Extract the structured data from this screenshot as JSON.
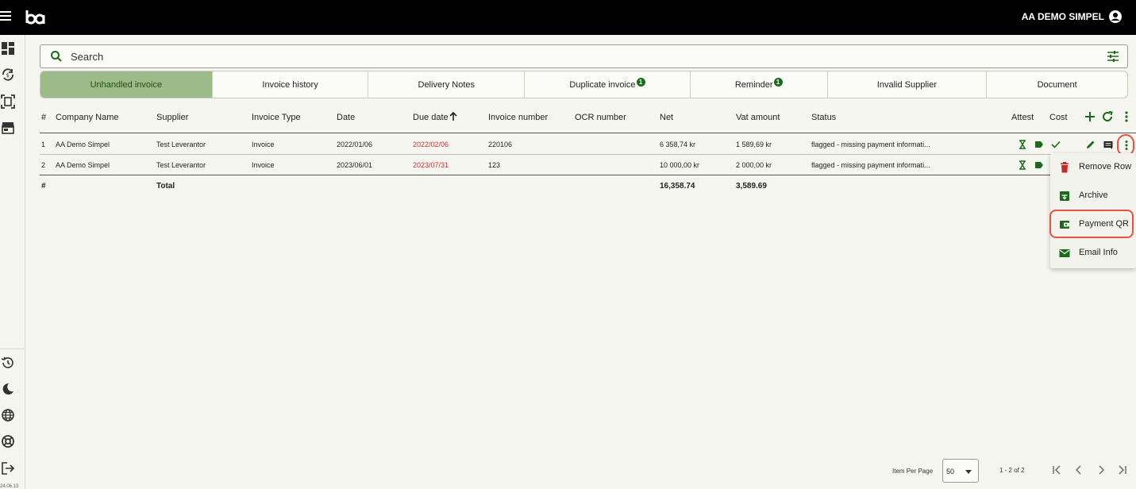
{
  "header": {
    "user_name": "AA DEMO SIMPEL"
  },
  "sidebar": {
    "version": "24.06.13"
  },
  "search": {
    "placeholder": "Search"
  },
  "tabs": [
    {
      "label": "Unhandled invoice",
      "badge": ""
    },
    {
      "label": "Invoice history",
      "badge": ""
    },
    {
      "label": "Delivery Notes",
      "badge": ""
    },
    {
      "label": "Duplicate invoice",
      "badge": "1"
    },
    {
      "label": "Reminder",
      "badge": "1"
    },
    {
      "label": "Invalid Supplier",
      "badge": ""
    },
    {
      "label": "Document",
      "badge": ""
    }
  ],
  "table": {
    "columns": {
      "index": "#",
      "company": "Company Name",
      "supplier": "Supplier",
      "type": "Invoice Type",
      "date": "Date",
      "due": "Due date",
      "number": "Invoice number",
      "ocr": "OCR number",
      "net": "Net",
      "vat": "Vat amount",
      "status": "Status",
      "attest": "Attest",
      "cost": "Cost"
    },
    "rows": [
      {
        "index": "1",
        "company": "AA Demo Simpel",
        "supplier": "Test Leverantor",
        "type": "Invoice",
        "date": "2022/01/06",
        "due": "2022/02/06",
        "number": "220106",
        "ocr": "",
        "net": "6 358,74 kr",
        "vat": "1 589,69 kr",
        "status": "flagged - missing payment informati..."
      },
      {
        "index": "2",
        "company": "AA Demo Simpel",
        "supplier": "Test Leverantor",
        "type": "Invoice",
        "date": "2023/06/01",
        "due": "2023/07/31",
        "number": "123",
        "ocr": "",
        "net": "10 000,00 kr",
        "vat": "2 000,00 kr",
        "status": "flagged - missing payment informati..."
      }
    ],
    "total": {
      "index": "#",
      "label": "Total",
      "net": "16,358.74",
      "vat": "3,589.69"
    }
  },
  "row_menu": {
    "items": [
      "Remove Row",
      "Archive",
      "Payment QR",
      "Email Info"
    ]
  },
  "paginator": {
    "items_per_page_label": "Item Per Page",
    "page_size": "50",
    "range": "1 - 2 of 2"
  },
  "colors": {
    "accent": "#1c6b1c",
    "active_tab": "#9dbb88",
    "due_date_overdue": "#d32f2f",
    "highlight": "#e8523e"
  }
}
